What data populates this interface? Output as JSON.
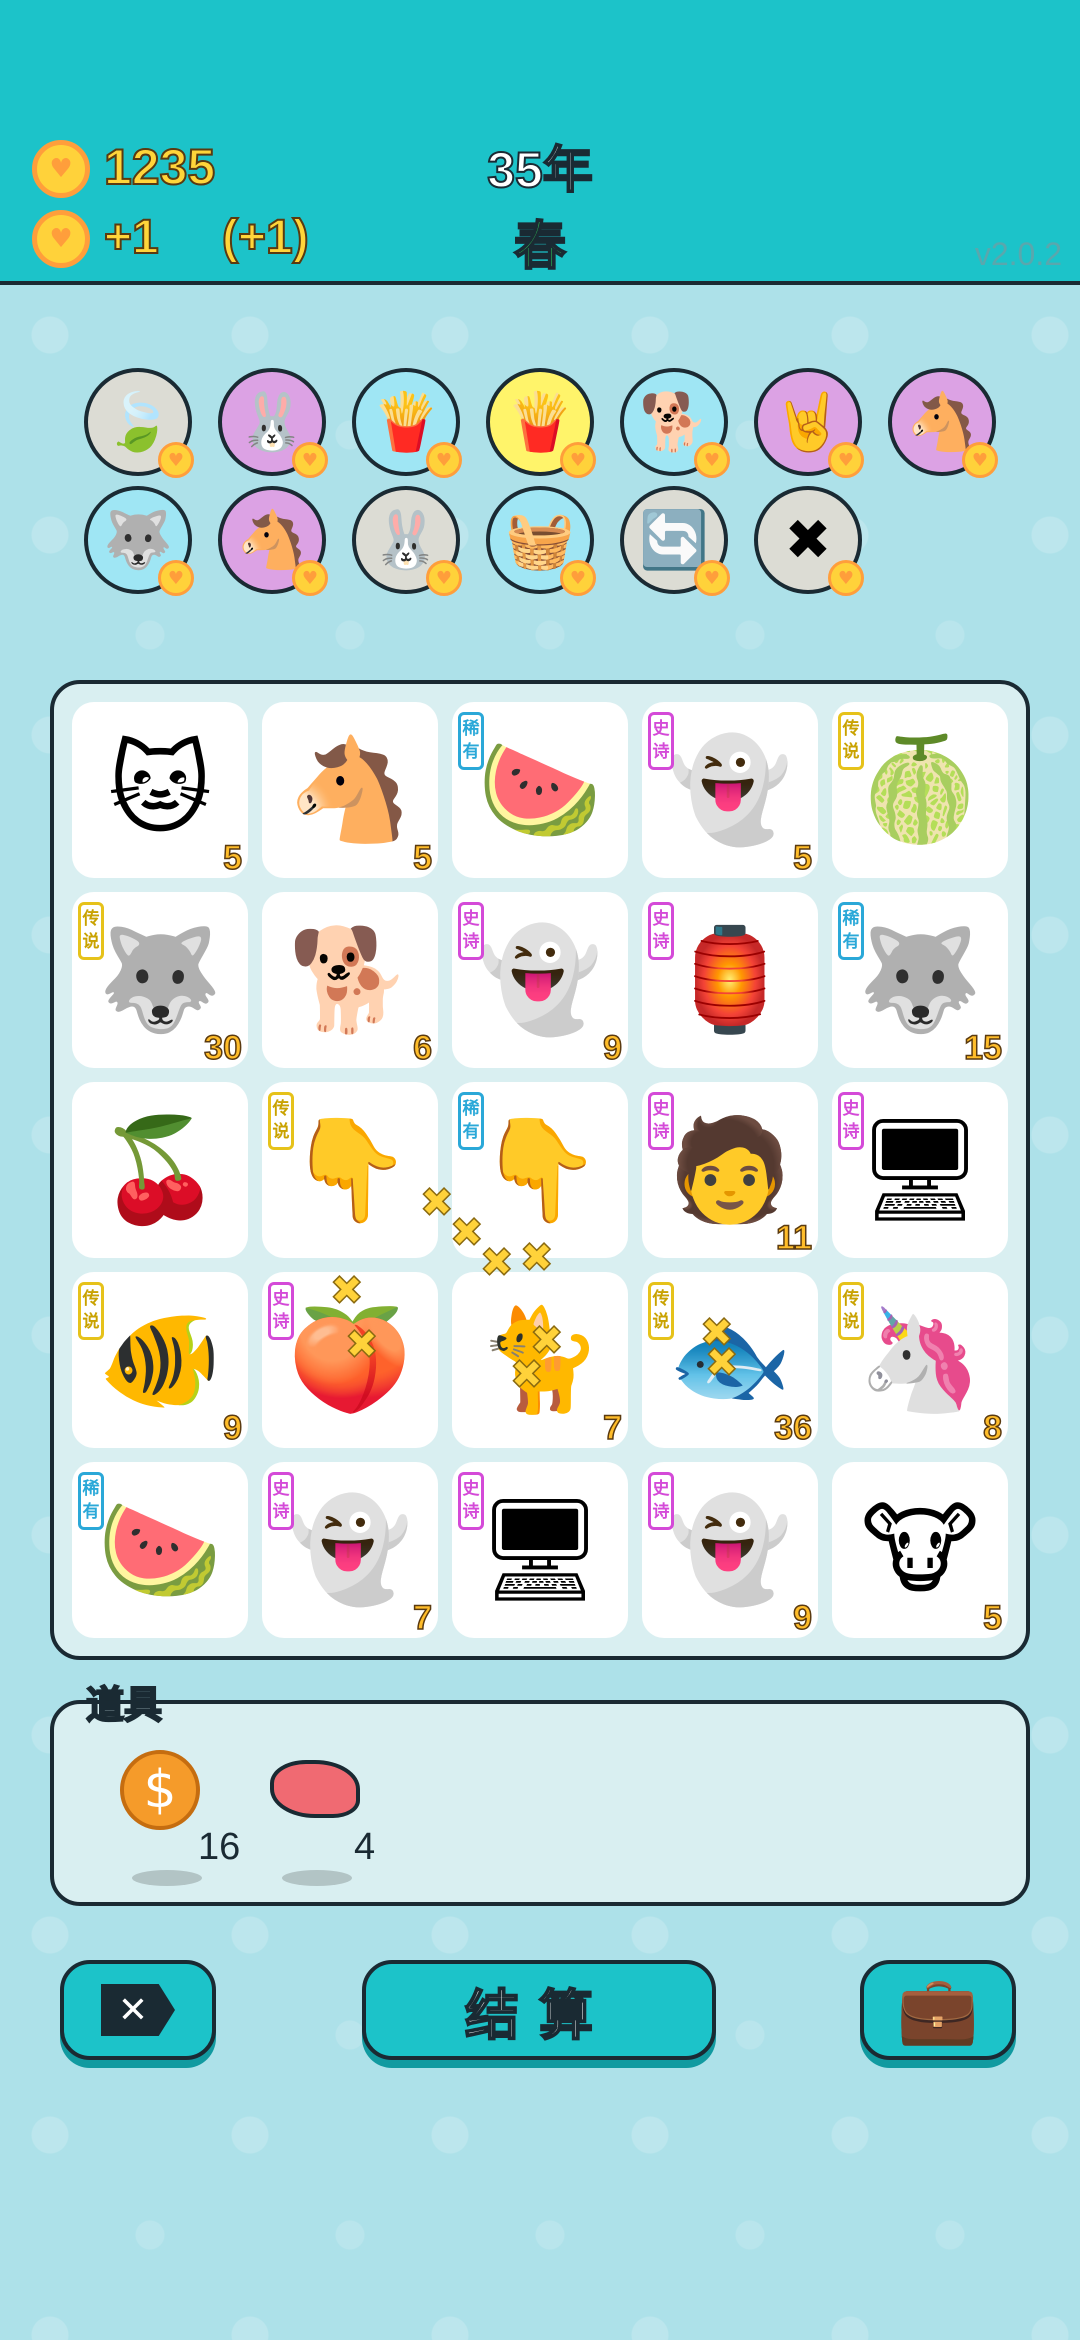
{
  "header": {
    "coins": "1235",
    "income": "+1",
    "income_bonus": "(+1)",
    "year": "35年",
    "season": "春",
    "version": "v2.0.2"
  },
  "symbol_row": [
    {
      "name": "leaf",
      "icon": "🍃",
      "color": "grey"
    },
    {
      "name": "rabbit",
      "icon": "🐰",
      "color": "purple"
    },
    {
      "name": "fries",
      "icon": "🍟",
      "color": "blue"
    },
    {
      "name": "fries-gold",
      "icon": "🍟",
      "color": "yellow"
    },
    {
      "name": "dog-sunglasses",
      "icon": "🐕",
      "color": "blue"
    },
    {
      "name": "rock-hand",
      "icon": "🤘",
      "color": "purple"
    },
    {
      "name": "horse-twins",
      "icon": "🐴",
      "color": "purple"
    },
    {
      "name": "husky",
      "icon": "🐺",
      "color": "blue"
    },
    {
      "name": "horse-twins-2",
      "icon": "🐴",
      "color": "purple"
    },
    {
      "name": "rabbit-2",
      "icon": "🐰",
      "color": "grey"
    },
    {
      "name": "fruit-basket",
      "icon": "🧺",
      "color": "blue"
    },
    {
      "name": "refresh",
      "icon": "🔄",
      "color": "grey"
    },
    {
      "name": "remove",
      "icon": "✖",
      "color": "grey"
    }
  ],
  "tags": {
    "rare": [
      "稀",
      "有"
    ],
    "epic": [
      "史",
      "诗"
    ],
    "legend": [
      "传",
      "说"
    ]
  },
  "board": [
    {
      "icon": "🐱",
      "count": "5",
      "tag": ""
    },
    {
      "icon": "🐴",
      "count": "5",
      "tag": ""
    },
    {
      "icon": "🍉",
      "count": "",
      "tag": "rare"
    },
    {
      "icon": "👻",
      "count": "5",
      "tag": "epic"
    },
    {
      "icon": "🍈",
      "count": "",
      "tag": "legend"
    },
    {
      "icon": "🐺",
      "count": "30",
      "tag": "legend"
    },
    {
      "icon": "🐕",
      "count": "6",
      "tag": ""
    },
    {
      "icon": "👻",
      "count": "9",
      "tag": "epic"
    },
    {
      "icon": "🏮",
      "count": "",
      "tag": "epic"
    },
    {
      "icon": "🐺",
      "count": "15",
      "tag": "rare"
    },
    {
      "icon": "🍒",
      "count": "",
      "tag": ""
    },
    {
      "icon": "👇",
      "count": "",
      "tag": "legend"
    },
    {
      "icon": "👇",
      "count": "",
      "tag": "rare"
    },
    {
      "icon": "🧑",
      "count": "11",
      "tag": "epic"
    },
    {
      "icon": "🖥",
      "count": "",
      "tag": "epic"
    },
    {
      "icon": "🐠",
      "count": "9",
      "tag": "legend"
    },
    {
      "icon": "🍑",
      "count": "",
      "tag": "epic"
    },
    {
      "icon": "🐈",
      "count": "7",
      "tag": ""
    },
    {
      "icon": "🐟",
      "count": "36",
      "tag": "legend"
    },
    {
      "icon": "🦄",
      "count": "8",
      "tag": "legend"
    },
    {
      "icon": "🍉",
      "count": "",
      "tag": "rare"
    },
    {
      "icon": "👻",
      "count": "7",
      "tag": "epic"
    },
    {
      "icon": "🖥",
      "count": "",
      "tag": "epic"
    },
    {
      "icon": "👻",
      "count": "9",
      "tag": "epic"
    },
    {
      "icon": "🐮",
      "count": "5",
      "tag": ""
    }
  ],
  "items_panel": {
    "label": "道具",
    "items": [
      {
        "name": "coin",
        "icon": "💲",
        "count": "16"
      },
      {
        "name": "liver",
        "icon": "🫀",
        "count": "4"
      }
    ]
  },
  "buttons": {
    "remove_glyph": "✕",
    "settle_label": "结算",
    "bag_icon": "💼"
  },
  "colors": {
    "header": "#1cc3c9",
    "background": "#ade1e9",
    "coin": "#ffd23a",
    "accent_green": "#2fd35a"
  }
}
